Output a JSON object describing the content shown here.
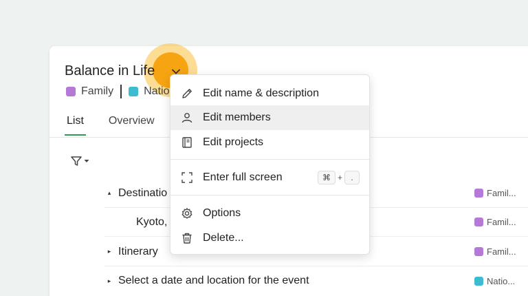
{
  "project": {
    "title": "Balance in Life",
    "tags": [
      {
        "label": "Family",
        "color": "#b57ad8"
      },
      {
        "label": "Natio",
        "color": "#3dbcd0"
      }
    ]
  },
  "tabs": [
    {
      "label": "List",
      "active": true
    },
    {
      "label": "Overview",
      "active": false
    }
  ],
  "rows": [
    {
      "label": "Destinatio",
      "caret": "▴",
      "tag": "Famil...",
      "tag_color": "#b57ad8"
    },
    {
      "label": "Kyoto,",
      "caret": "",
      "tag": "Famil...",
      "tag_color": "#b57ad8"
    },
    {
      "label": "Itinerary",
      "caret": "▸",
      "tag": "Famil...",
      "tag_color": "#b57ad8"
    },
    {
      "label": "Select a date and location for the event",
      "caret": "▸",
      "tag": "Natio...",
      "tag_color": "#3dbcd0"
    }
  ],
  "menu": {
    "items": [
      {
        "label": "Edit name & description",
        "icon": "pencil-icon"
      },
      {
        "label": "Edit members",
        "icon": "person-icon"
      },
      {
        "label": "Edit projects",
        "icon": "notebook-icon"
      },
      {
        "label": "Enter full screen",
        "icon": "fullscreen-icon"
      },
      {
        "label": "Options",
        "icon": "gear-icon"
      },
      {
        "label": "Delete...",
        "icon": "trash-icon"
      }
    ],
    "shortcut": {
      "key1": "⌘",
      "plus": "+",
      "key2": "."
    }
  },
  "colors": {
    "accent_green": "#2e9a52",
    "highlight": "#f7a412"
  }
}
